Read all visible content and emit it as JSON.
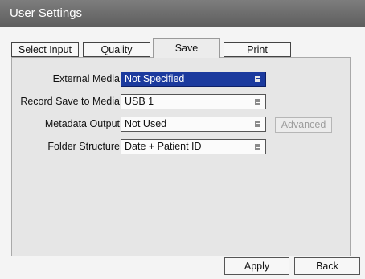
{
  "window": {
    "title": "User Settings"
  },
  "tabs": [
    {
      "label": "Select Input"
    },
    {
      "label": "Quality"
    },
    {
      "label": "Save"
    },
    {
      "label": "Print"
    }
  ],
  "active_tab": "Save",
  "settings": [
    {
      "label": "External Media",
      "value": "Not Specified"
    },
    {
      "label": "Record Save to Media",
      "value": "USB 1"
    },
    {
      "label": "Metadata Output",
      "value": "Not Used"
    },
    {
      "label": "Folder Structure",
      "value": "Date + Patient ID"
    }
  ],
  "advanced_button": {
    "label": "Advanced",
    "enabled": false
  },
  "footer": {
    "apply_label": "Apply",
    "back_label": "Back"
  }
}
